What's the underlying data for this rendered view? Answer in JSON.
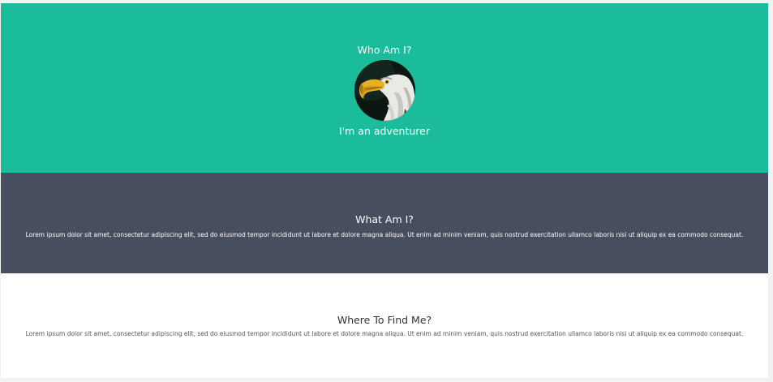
{
  "hero": {
    "title": "Who Am I?",
    "subtitle": "I'm an adventurer",
    "avatar_icon": "eagle-photo"
  },
  "what": {
    "title": "What Am I?",
    "text": "Lorem ipsum dolor sit amet, consectetur adipiscing elit, sed do eiusmod tempor incididunt ut labore et dolore magna aliqua. Ut enim ad minim veniam, quis nostrud exercitation ullamco laboris nisi ut aliquip ex ea commodo consequat."
  },
  "where": {
    "title": "Where To Find Me?",
    "text": "Lorem ipsum dolor sit amet, consectetur adipiscing elit, sed do eiusmod tempor incididunt ut labore et dolore magna aliqua. Ut enim ad minim veniam, quis nostrud exercitation ullamco laboris nisi ut aliquip ex ea commodo consequat."
  },
  "colors": {
    "hero_bg": "#1abc9c",
    "what_bg": "#474e5d",
    "where_bg": "#ffffff"
  }
}
